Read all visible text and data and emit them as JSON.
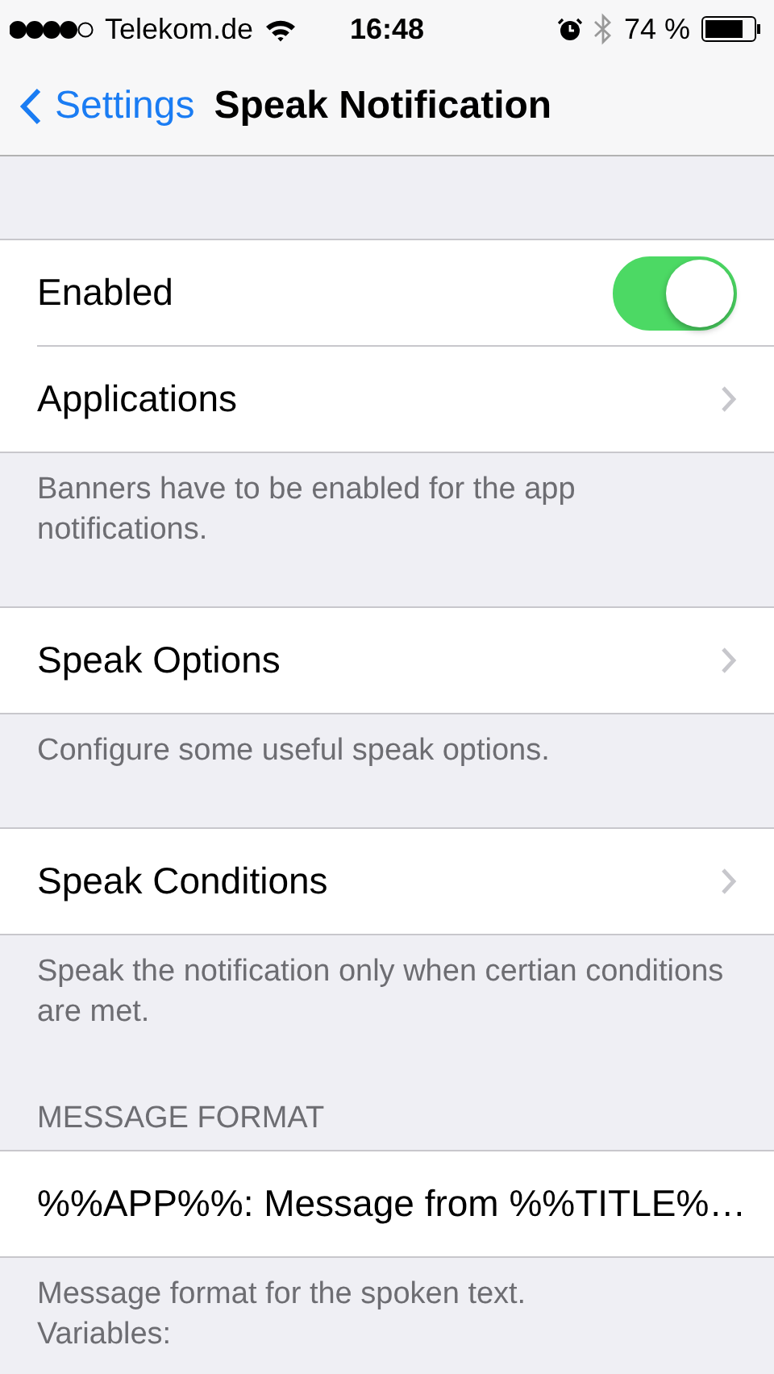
{
  "status_bar": {
    "carrier": "Telekom.de",
    "time": "16:48",
    "battery": "74 %"
  },
  "nav": {
    "back": "Settings",
    "title": "Speak Notification"
  },
  "sections": [
    {
      "rows": [
        {
          "kind": "toggle",
          "label": "Enabled",
          "on": true
        },
        {
          "kind": "disclosure",
          "label": "Applications"
        }
      ],
      "footer": [
        "Banners have to be enabled for the app notifications."
      ]
    },
    {
      "rows": [
        {
          "kind": "disclosure",
          "label": "Speak Options"
        }
      ],
      "footer": [
        "Configure some useful speak options."
      ]
    },
    {
      "rows": [
        {
          "kind": "disclosure",
          "label": "Speak Conditions"
        }
      ],
      "footer": [
        "Speak the notification only when certian conditions are met."
      ]
    },
    {
      "header": "MESSAGE FORMAT",
      "rows": [
        {
          "kind": "value",
          "label": "%%APP%%: Message from %%TITLE%…"
        }
      ],
      "footer": [
        "Message format for the spoken text.",
        "Variables:"
      ]
    }
  ]
}
